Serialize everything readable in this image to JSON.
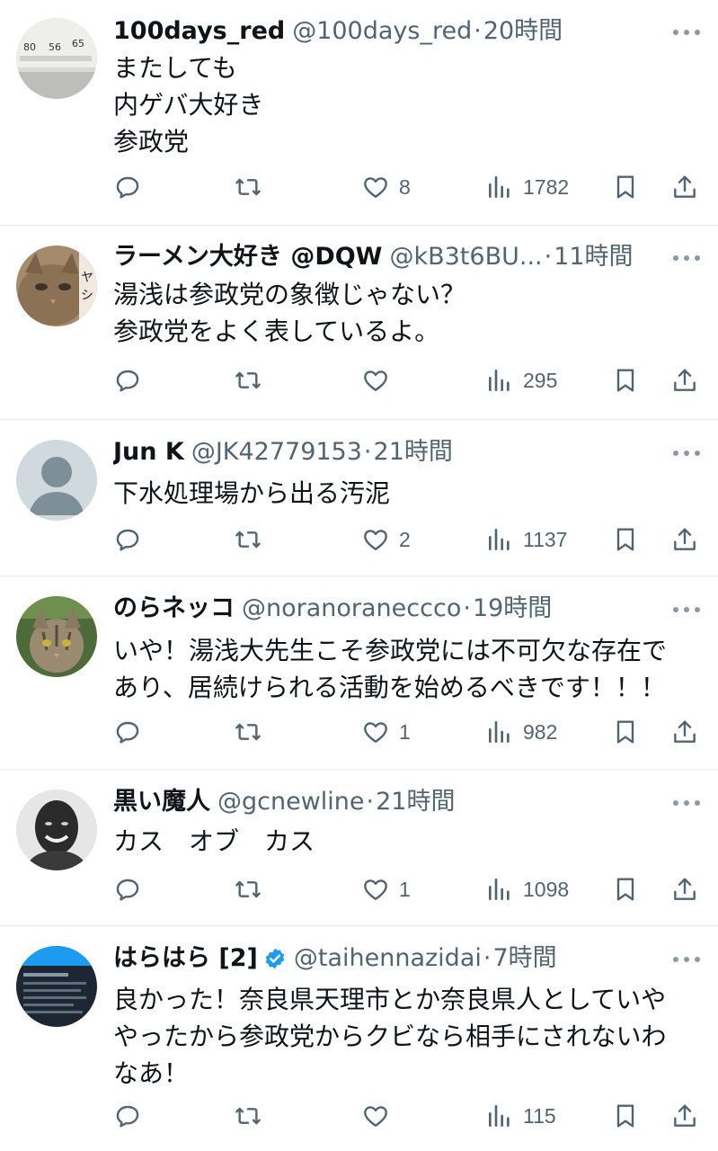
{
  "tweets": [
    {
      "name": "100days_red",
      "handle": "@100days_red",
      "separator": "·",
      "time": "20時間",
      "verified": false,
      "avatar_icon": "blood-pressure-monitor-photo-avatar",
      "lines": [
        "またしても",
        "内ゲバ大好き",
        "参政党"
      ],
      "likes": "8",
      "views": "1782"
    },
    {
      "name": "ラーメン大好き @DQW",
      "handle": "@kB3t6BU...",
      "separator": "·",
      "time": "11時間",
      "verified": false,
      "avatar_icon": "cat-photo-avatar",
      "lines": [
        "湯浅は参政党の象徴じゃない？",
        "参政党をよく表しているよ。"
      ],
      "likes": "",
      "views": "295"
    },
    {
      "name": "Jun K",
      "handle": "@JK42779153",
      "separator": "·",
      "time": "21時間",
      "verified": false,
      "avatar_icon": "default-person-avatar",
      "lines": [
        "下水処理場から出る汚泥"
      ],
      "likes": "2",
      "views": "1137"
    },
    {
      "name": "のらネッコ",
      "handle": "@noranoraneccco",
      "separator": "·",
      "time": "19時間",
      "verified": false,
      "avatar_icon": "tabby-cat-photo-avatar",
      "lines": [
        "いや！湯浅大先生こそ参政党には不可欠な存在で",
        "あり、居続けられる活動を始めるべきです！！！"
      ],
      "likes": "1",
      "views": "982"
    },
    {
      "name": "黒い魔人",
      "handle": "@gcnewline",
      "separator": "·",
      "time": "21時間",
      "verified": false,
      "avatar_icon": "smiling-man-portrait-avatar",
      "lines": [
        "カス　オブ　カス"
      ],
      "likes": "1",
      "views": "1098"
    },
    {
      "name": "はらはら [2]",
      "handle": "@taihennazidai",
      "separator": "·",
      "time": "7時間",
      "verified": true,
      "avatar_icon": "document-screenshot-avatar",
      "lines": [
        "良かった！奈良県天理市とか奈良県人としていや",
        "やったから参政党からクビなら相手にされないわ",
        "なあ！"
      ],
      "likes": "",
      "views": "115"
    }
  ],
  "colors": {
    "text": "#0f1419",
    "secondary": "#536471",
    "divider": "#e6ecf0",
    "verified": "#1d9bf0"
  },
  "icons": [
    "reply-icon",
    "retweet-icon",
    "like-icon",
    "views-icon",
    "bookmark-icon",
    "share-icon",
    "more-icon",
    "verified-badge-icon"
  ]
}
